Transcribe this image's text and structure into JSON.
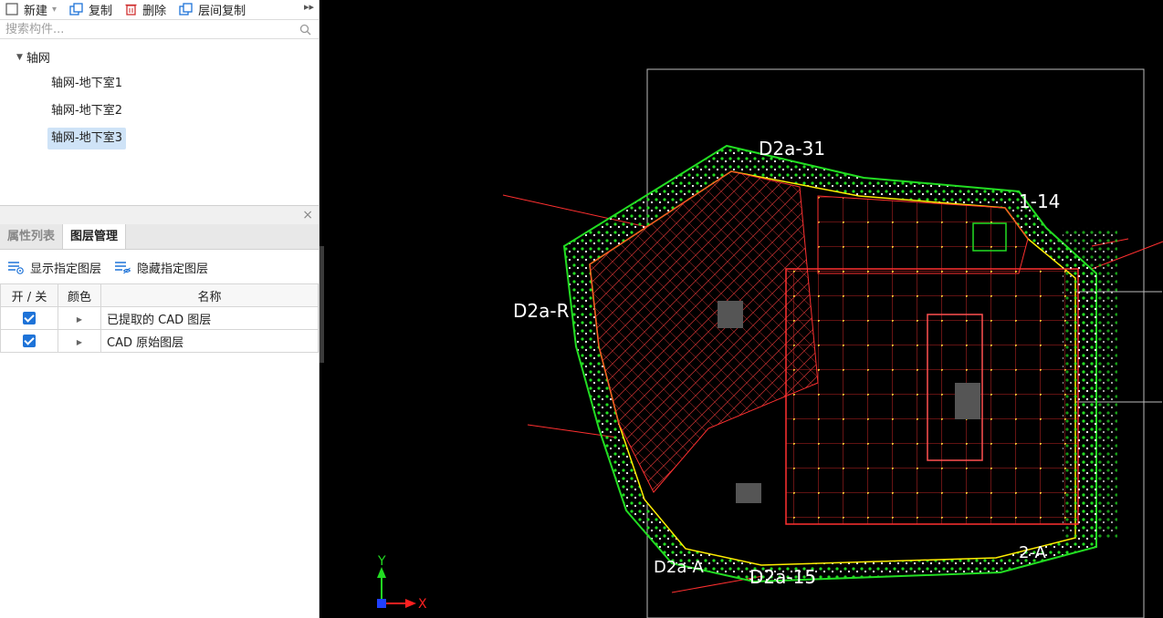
{
  "toolbar": {
    "new_label": "新建",
    "copy_label": "复制",
    "delete_label": "删除",
    "floor_copy_label": "层间复制",
    "more_glyph": "▸▸"
  },
  "search": {
    "placeholder": "搜索构件..."
  },
  "tree": {
    "root_label": "轴网",
    "items": [
      {
        "label": "轴网-地下室1"
      },
      {
        "label": "轴网-地下室2"
      },
      {
        "label": "轴网-地下室3"
      }
    ],
    "selected_index": 2
  },
  "tabs": [
    {
      "label": "属性列表"
    },
    {
      "label": "图层管理"
    }
  ],
  "active_tab": 1,
  "layer_actions": {
    "show_label": "显示指定图层",
    "hide_label": "隐藏指定图层"
  },
  "layers_table": {
    "headers": {
      "toggle": "开 / 关",
      "color": "颜色",
      "name": "名称"
    },
    "rows": [
      {
        "on": true,
        "name": "已提取的 CAD 图层"
      },
      {
        "on": true,
        "name": "CAD 原始图层"
      }
    ]
  },
  "canvas": {
    "axis_x_label": "X",
    "axis_y_label": "Y",
    "grid_labels": {
      "top_1": "D2a-31",
      "right_1": "1-14",
      "right_2": "2-A",
      "left_1": "D2a-R",
      "bottom_left": "D2a-A",
      "bottom_row": "D2a-15"
    }
  },
  "colors": {
    "accent": "#1e73d8",
    "cad_green": "#22dd22",
    "cad_red": "#ff3030",
    "cad_yellow": "#ffee00",
    "selected_row": "#cfe3f7"
  }
}
